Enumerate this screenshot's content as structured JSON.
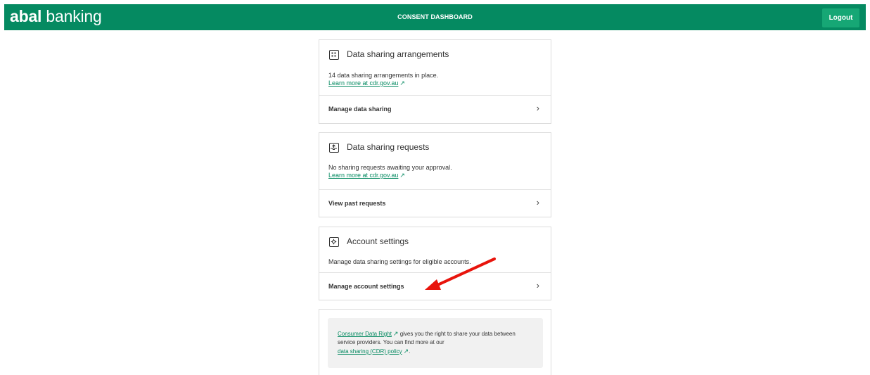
{
  "header": {
    "logo_bold": "abal",
    "logo_light": " banking",
    "title": "CONSENT DASHBOARD",
    "logout_label": "Logout",
    "brand_color": "#058a61"
  },
  "cards": [
    {
      "title": "Data sharing arrangements",
      "icon": "grid-icon",
      "description": "14 data sharing arrangements in place.",
      "link": "Learn more at cdr.gov.au",
      "action": "Manage data sharing"
    },
    {
      "title": "Data sharing requests",
      "icon": "inbox-upload-icon",
      "description": "No sharing requests awaiting your approval.",
      "link": "Learn more at cdr.gov.au",
      "action": "View past requests"
    },
    {
      "title": "Account settings",
      "icon": "gear-icon",
      "description": "Manage data sharing settings for eligible accounts.",
      "action": "Manage account settings"
    }
  ],
  "info": {
    "link1": "Consumer Data Right",
    "text1": " gives you the right to share your data between service providers. You can find more at our",
    "link2": "data sharing (CDR) policy",
    "text2": "."
  },
  "annotation_color": "#e8140c"
}
